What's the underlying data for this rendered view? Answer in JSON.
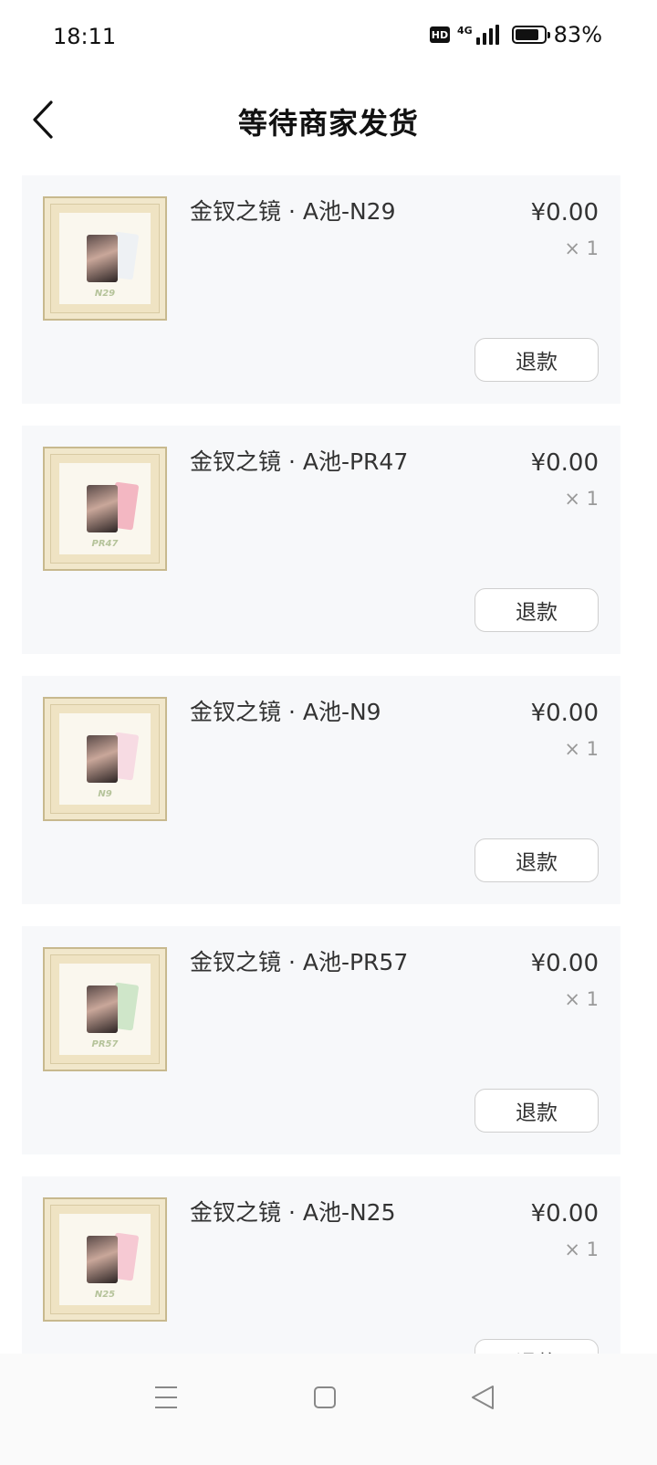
{
  "status_bar": {
    "time": "18:11",
    "hd_badge": "HD",
    "network_label": "4G",
    "battery_percent": "83%",
    "battery_level": 0.83
  },
  "header": {
    "title": "等待商家发货",
    "back_icon": "chevron-left-icon"
  },
  "orders": [
    {
      "name": "金钗之镜 · A池-N29",
      "price": "¥0.00",
      "qty": "× 1",
      "code": "N29",
      "refund_label": "退款",
      "card_back_color": "#eef1f4"
    },
    {
      "name": "金钗之镜 · A池-PR47",
      "price": "¥0.00",
      "qty": "× 1",
      "code": "PR47",
      "refund_label": "退款",
      "card_back_color": "#f3b7c2"
    },
    {
      "name": "金钗之镜 · A池-N9",
      "price": "¥0.00",
      "qty": "× 1",
      "code": "N9",
      "refund_label": "退款",
      "card_back_color": "#f7dbe3"
    },
    {
      "name": "金钗之镜 · A池-PR57",
      "price": "¥0.00",
      "qty": "× 1",
      "code": "PR57",
      "refund_label": "退款",
      "card_back_color": "#cfe6c9"
    },
    {
      "name": "金钗之镜 · A池-N25",
      "price": "¥0.00",
      "qty": "× 1",
      "code": "N25",
      "refund_label": "退款",
      "card_back_color": "#f6c9d3"
    }
  ],
  "nav_bar": {
    "menu_icon": "menu-icon",
    "home_icon": "home-square-icon",
    "back_icon": "back-triangle-icon"
  }
}
